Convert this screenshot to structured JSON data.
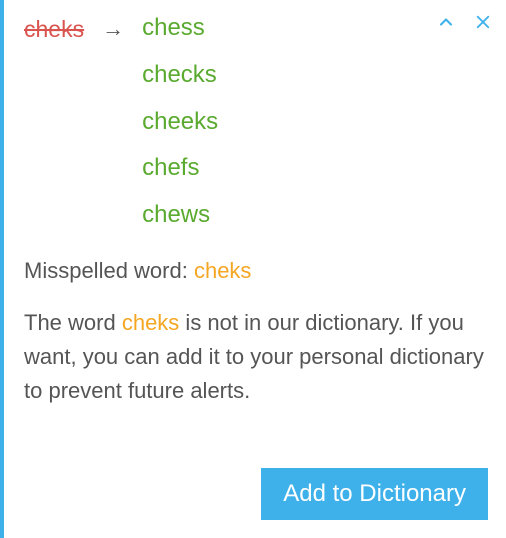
{
  "word": "cheks",
  "arrow": "→",
  "suggestions": [
    "chess",
    "checks",
    "cheeks",
    "chefs",
    "chews"
  ],
  "labels": {
    "misspelled_prefix": "Misspelled word: ",
    "explain_pre": "The word ",
    "explain_post": " is not in our dictionary. If you want, you can add it to your personal dictionary to prevent future alerts.",
    "add_button": "Add to Dictionary"
  },
  "icons": {
    "collapse": "chevron-up-icon",
    "close": "close-icon"
  }
}
